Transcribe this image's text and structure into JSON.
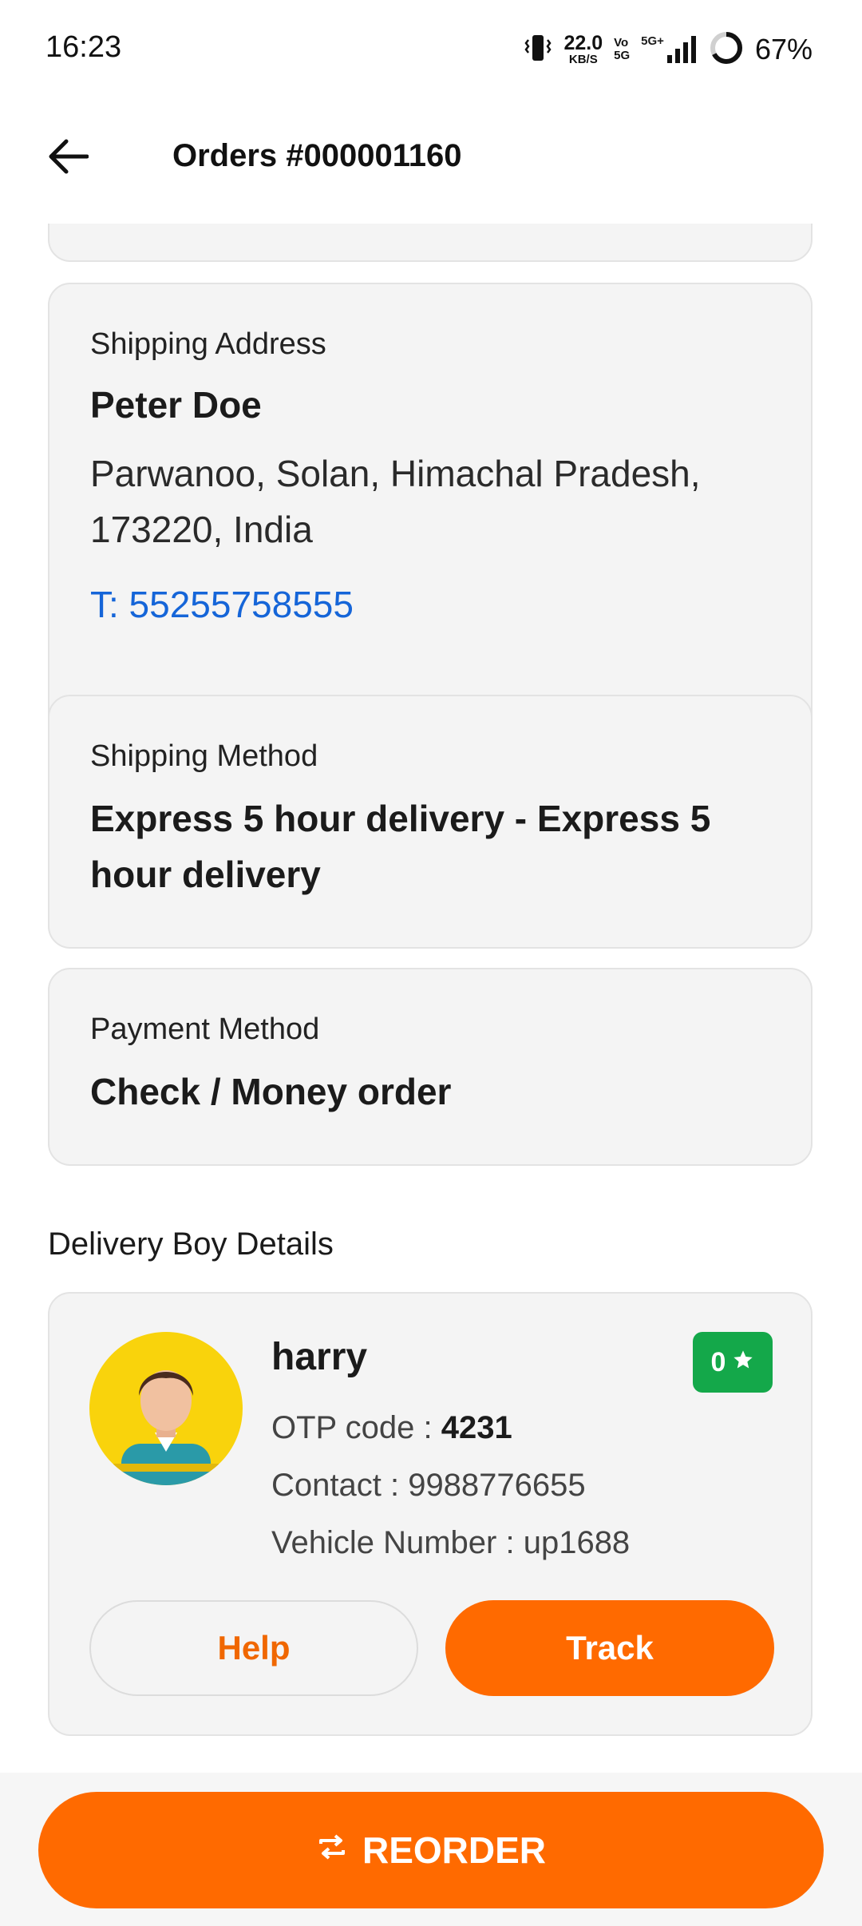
{
  "status_bar": {
    "time": "16:23",
    "net_speed_value": "22.0",
    "net_speed_unit": "KB/S",
    "vo_top": "Vo",
    "vo_bottom": "5G",
    "network_type": "5G+",
    "battery": "67%",
    "icons": [
      "vibrate-icon",
      "signal-icon",
      "battery-ring-icon"
    ]
  },
  "app_bar": {
    "title": "Orders #000001160",
    "back_icon": "arrow-left-icon"
  },
  "shipping_address": {
    "label": "Shipping Address",
    "name": "Peter Doe",
    "address_line1": "Parwanoo, Solan,  Himachal Pradesh,",
    "address_line2": "173220, India",
    "phone": "T: 55255758555"
  },
  "shipping_method": {
    "label": "Shipping Method",
    "value_line1": "Express 5 hour delivery - Express 5",
    "value_line2": "hour delivery"
  },
  "payment_method": {
    "label": "Payment Method",
    "value": "Check / Money order"
  },
  "delivery_boy": {
    "heading": "Delivery Boy Details",
    "name": "harry",
    "rating": "0",
    "otp_label": "OTP code : ",
    "otp_value": "4231",
    "contact": "Contact : 9988776655",
    "vehicle": "Vehicle Number : up1688",
    "help_label": "Help",
    "track_label": "Track"
  },
  "reorder": {
    "label": "REORDER",
    "icon": "repeat-icon"
  },
  "colors": {
    "accent": "#ff6a00",
    "link": "#1565d8",
    "rating_badge": "#14a84a",
    "card_bg": "#f4f4f4"
  }
}
